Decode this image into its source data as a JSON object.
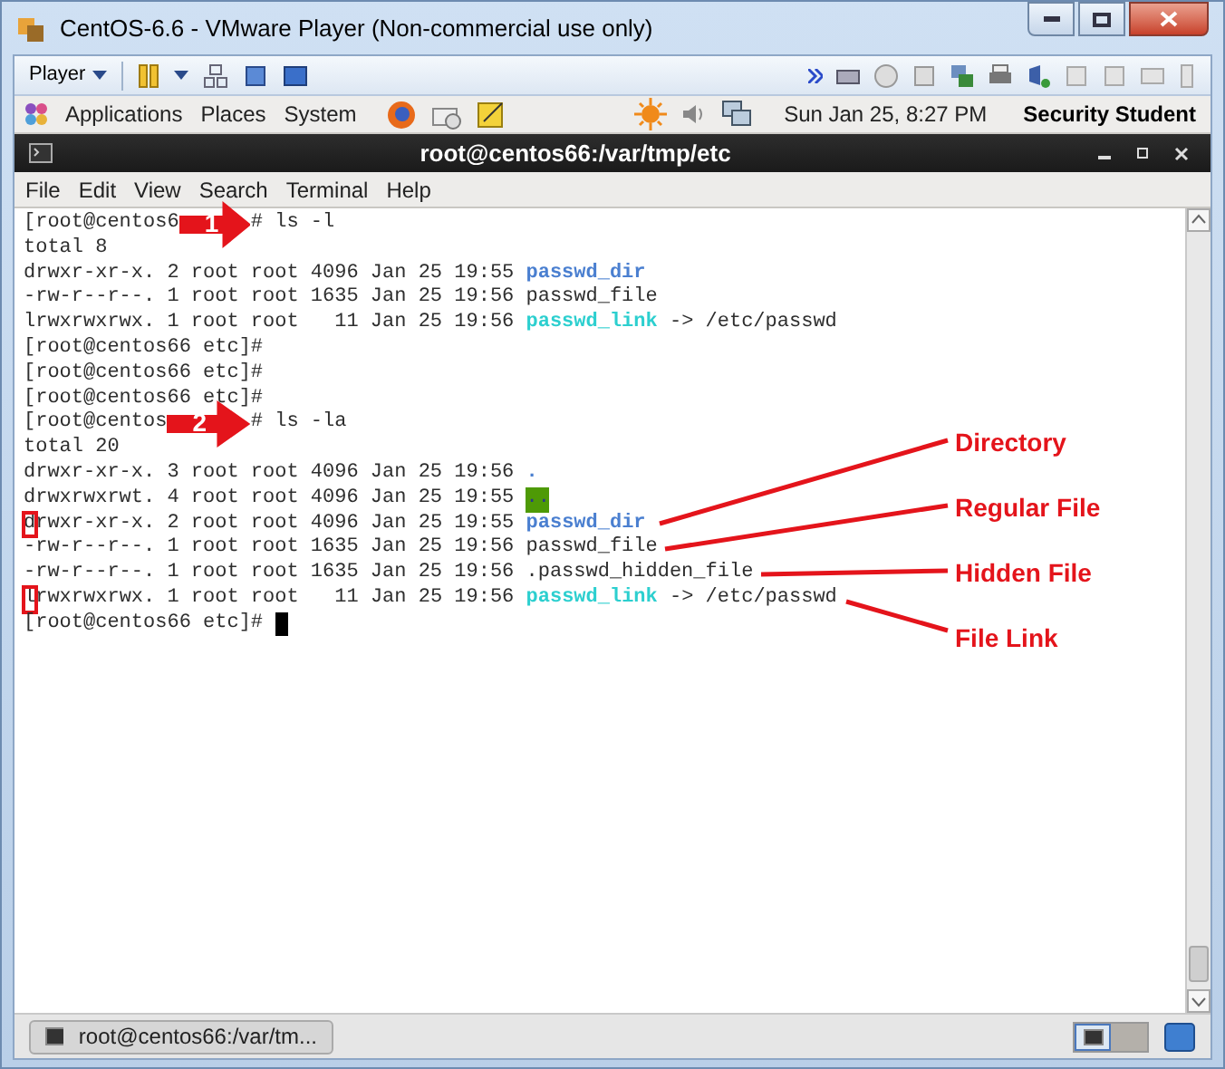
{
  "window": {
    "title": "CentOS-6.6 - VMware Player (Non-commercial use only)"
  },
  "toolbar": {
    "player_label": "Player"
  },
  "panel": {
    "menus": [
      "Applications",
      "Places",
      "System"
    ],
    "clock": "Sun Jan 25,  8:27 PM",
    "user": "Security Student"
  },
  "terminal": {
    "title": "root@centos66:/var/tmp/etc",
    "menu": [
      "File",
      "Edit",
      "View",
      "Search",
      "Terminal",
      "Help"
    ],
    "lines": [
      {
        "kind": "arrow",
        "before": "[root@centos6",
        "number": "1",
        "after": "# ls -l"
      },
      {
        "kind": "text",
        "segs": [
          {
            "kind": "plain",
            "text": "total 8"
          }
        ]
      },
      {
        "kind": "text",
        "segs": [
          {
            "kind": "plain",
            "text": "drwxr-xr-x. 2 root root 4096 Jan 25 19:55 "
          },
          {
            "kind": "dir",
            "text": "passwd_dir"
          }
        ]
      },
      {
        "kind": "text",
        "segs": [
          {
            "kind": "plain",
            "text": "-rw-r--r--. 1 root root 1635 Jan 25 19:56 passwd_file"
          }
        ]
      },
      {
        "kind": "text",
        "segs": [
          {
            "kind": "plain",
            "text": "lrwxrwxrwx. 1 root root   11 Jan 25 19:56 "
          },
          {
            "kind": "link",
            "text": "passwd_link"
          },
          {
            "kind": "plain",
            "text": " -> /etc/passwd"
          }
        ]
      },
      {
        "kind": "text",
        "segs": [
          {
            "kind": "plain",
            "text": "[root@centos66 etc]#"
          }
        ]
      },
      {
        "kind": "text",
        "segs": [
          {
            "kind": "plain",
            "text": "[root@centos66 etc]#"
          }
        ]
      },
      {
        "kind": "text",
        "segs": [
          {
            "kind": "plain",
            "text": "[root@centos66 etc]#"
          }
        ]
      },
      {
        "kind": "arrow",
        "before": "[root@centos",
        "number": "2",
        "after": "# ls -la"
      },
      {
        "kind": "text",
        "segs": [
          {
            "kind": "plain",
            "text": "total 20"
          }
        ]
      },
      {
        "kind": "text",
        "segs": [
          {
            "kind": "plain",
            "text": "drwxr-xr-x. 3 root root 4096 Jan 25 19:56 "
          },
          {
            "kind": "dir",
            "text": "."
          }
        ]
      },
      {
        "kind": "text",
        "segs": [
          {
            "kind": "plain",
            "text": "drwxrwxrwt. 4 root root 4096 Jan 25 19:55 "
          },
          {
            "kind": "sticky",
            "text": ".."
          }
        ]
      },
      {
        "kind": "text",
        "segs": [
          {
            "kind": "boxed",
            "text": "d"
          },
          {
            "kind": "plain",
            "text": "rwxr-xr-x. 2 root root 4096 Jan 25 19:55 "
          },
          {
            "kind": "dir",
            "text": "passwd_dir"
          }
        ]
      },
      {
        "kind": "text",
        "segs": [
          {
            "kind": "plain",
            "text": "-rw-r--r--. 1 root root 1635 Jan 25 19:56 passwd_file"
          }
        ]
      },
      {
        "kind": "text",
        "segs": [
          {
            "kind": "plain",
            "text": "-rw-r--r--. 1 root root 1635 Jan 25 19:56 .passwd_hidden_file"
          }
        ]
      },
      {
        "kind": "text",
        "segs": [
          {
            "kind": "boxed",
            "text": "l"
          },
          {
            "kind": "plain",
            "text": "rwxrwxrwx. 1 root root   11 Jan 25 19:56 "
          },
          {
            "kind": "link",
            "text": "passwd_link"
          },
          {
            "kind": "plain",
            "text": " -> /etc/passwd"
          }
        ]
      },
      {
        "kind": "prompt",
        "segs": [
          {
            "kind": "plain",
            "text": "[root@centos66 etc]# "
          }
        ]
      }
    ]
  },
  "annotations": [
    "Directory",
    "Regular File",
    "Hidden File",
    "File Link"
  ],
  "taskbar": {
    "item": "root@centos66:/var/tm..."
  }
}
